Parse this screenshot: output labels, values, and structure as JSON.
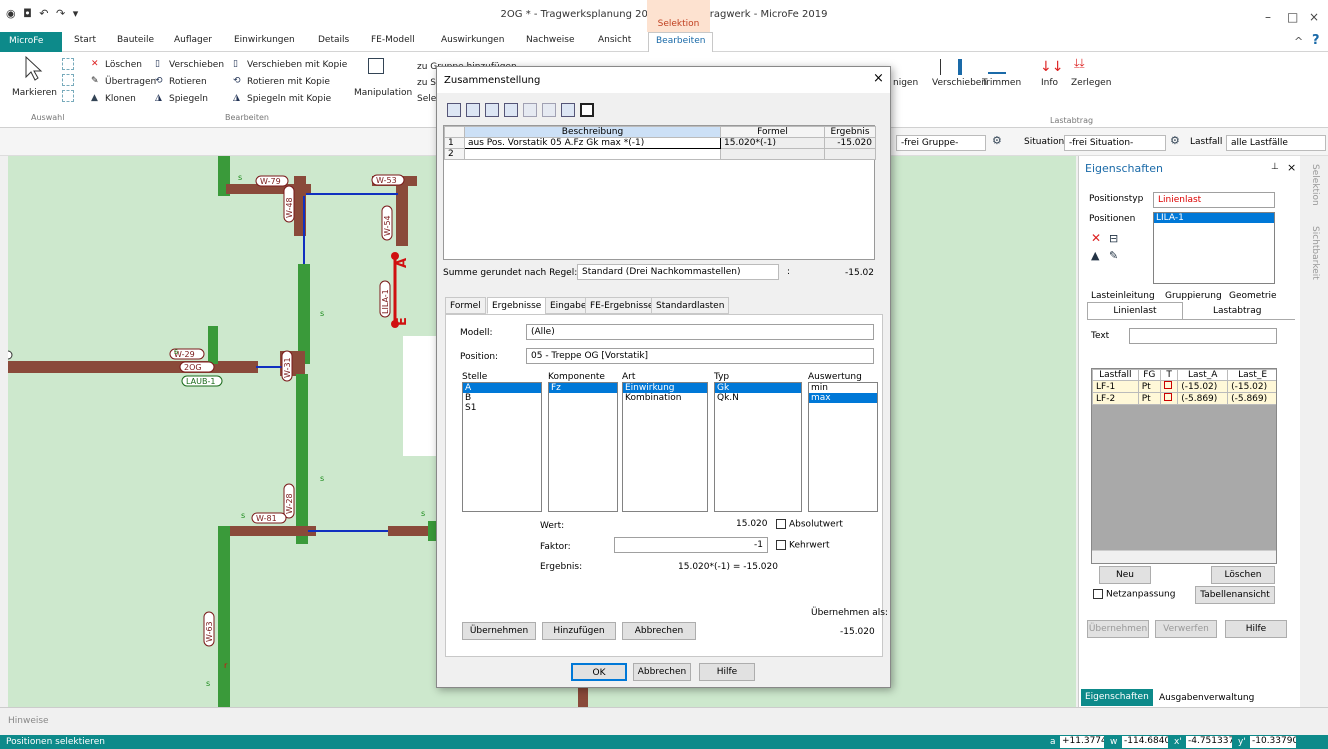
{
  "app": {
    "title": "2OG * - Tragwerksplanung 2019 - Plattentragwerk - MicroFe 2019",
    "context_tab": "Selektion",
    "minimize": "–",
    "restore": "□",
    "close": "×",
    "help": "?",
    "collapse": "^"
  },
  "tabs": [
    {
      "label": "MicroFe"
    },
    {
      "label": "Start"
    },
    {
      "label": "Bauteile"
    },
    {
      "label": "Auflager"
    },
    {
      "label": "Einwirkungen"
    },
    {
      "label": "Details"
    },
    {
      "label": "FE-Modell"
    },
    {
      "label": "Auswirkungen"
    },
    {
      "label": "Nachweise"
    },
    {
      "label": "Ansicht"
    },
    {
      "label": "Bearbeiten"
    }
  ],
  "ribbon": {
    "markieren": "Markieren",
    "auswahl": "Auswahl",
    "loeschen": "Löschen",
    "uebertragen": "Übertragen",
    "klonen": "Klonen",
    "verschieben": "Verschieben",
    "rotieren": "Rotieren",
    "spiegeln": "Spiegeln",
    "verschieben_kopie": "Verschieben mit Kopie",
    "rotieren_kopie": "Rotieren mit Kopie",
    "spiegeln_kopie": "Spiegeln mit Kopie",
    "bearbeiten": "Bearbeiten",
    "manipulation": "Manipulation",
    "zu_gruppe": "zu Gruppe hinzufügen",
    "zu_s": "zu S",
    "sele": "Sele",
    "nigen": "nigen",
    "verschieben2": "Verschieben",
    "trimmen": "Trimmen",
    "info": "Info",
    "zerlegen": "Zerlegen",
    "lastabtrag": "Lastabtrag"
  },
  "filterbar": {
    "gruppe": "-frei Gruppe-",
    "situation_label": "Situation",
    "situation": "-frei Situation-",
    "lastfall_label": "Lastfall",
    "lastfall": "alle Lastfälle"
  },
  "canvas_labels": [
    "W-79",
    "W-48",
    "W-53",
    "W-54",
    "W-29",
    "2OG",
    "LAUB-1",
    "W-31",
    "W-28",
    "W-81",
    "W-63",
    "LILA-1",
    "s",
    "A",
    "E",
    "r"
  ],
  "dialog": {
    "title": "Zusammenstellung",
    "close": "×",
    "grid": {
      "headers": [
        "Beschreibung",
        "Formel",
        "Ergebnis"
      ],
      "rows": [
        {
          "n": "1",
          "beschreibung": "aus Pos. Vorstatik 05 A.Fz Gk max *(-1)",
          "formel": "15.020*(-1)",
          "ergebnis": "-15.020"
        },
        {
          "n": "2",
          "beschreibung": "",
          "formel": "",
          "ergebnis": ""
        }
      ]
    },
    "summe_label": "Summe gerundet nach Regel:",
    "summe_regel": "Standard (Drei Nachkommastellen)",
    "summe_colon": ":",
    "summe_wert": "-15.02",
    "tabs": [
      "Formel",
      "Ergebnisse",
      "Eingabe",
      "FE-Ergebnisse",
      "Standardlasten"
    ],
    "modell_label": "Modell:",
    "modell": "(Alle)",
    "position_label": "Position:",
    "position": "05 - Treppe OG [Vorstatik]",
    "cols": {
      "stelle": "Stelle",
      "komponente": "Komponente",
      "art": "Art",
      "typ": "Typ",
      "auswertung": "Auswertung"
    },
    "stelle": [
      "A",
      "B",
      "S1"
    ],
    "komponente": [
      "Fz"
    ],
    "art": [
      "Einwirkung",
      "Kombination"
    ],
    "typ": [
      "Gk",
      "Qk.N"
    ],
    "auswertung": [
      "min",
      "max"
    ],
    "wert_label": "Wert:",
    "wert": "15.020",
    "absolutwert": "Absolutwert",
    "faktor_label": "Faktor:",
    "faktor": "-1",
    "kehrwert": "Kehrwert",
    "ergebnis_label": "Ergebnis:",
    "ergebnis": "15.020*(-1) = -15.020",
    "uebernehmen_als": "Übernehmen als:",
    "uebernehmen_wert": "-15.020",
    "btn_uebernehmen": "Übernehmen",
    "btn_hinzufuegen": "Hinzufügen",
    "btn_abbrechen": "Abbrechen",
    "ok": "OK",
    "abbrechen": "Abbrechen",
    "hilfe": "Hilfe"
  },
  "props": {
    "title": "Eigenschaften",
    "pin": "⊥",
    "close": "×",
    "positionstyp_label": "Positionstyp",
    "positionstyp": "Linienlast",
    "positionen_label": "Positionen",
    "positionen": [
      "LILA-1"
    ],
    "tabs_row1": [
      "Lasteinleitung",
      "Gruppierung",
      "Geometrie"
    ],
    "tabs_row2": [
      "Linienlast",
      "Lastabtrag"
    ],
    "text_label": "Text",
    "table_headers": [
      "Lastfall",
      "FG",
      "T",
      "Last_A",
      "Last_E"
    ],
    "table_rows": [
      {
        "lf": "LF-1",
        "fg": "Pt",
        "a": "(-15.02)",
        "e": "(-15.02)"
      },
      {
        "lf": "LF-2",
        "fg": "Pt",
        "a": "(-5.869)",
        "e": "(-5.869)"
      }
    ],
    "neu": "Neu",
    "loeschen": "Löschen",
    "netzanpassung": "Netzanpassung",
    "tabellenansicht": "Tabellenansicht",
    "uebernehmen": "Übernehmen",
    "verwerfen": "Verwerfen",
    "hilfe": "Hilfe",
    "bottom_tabs": [
      "Eigenschaften",
      "Ausgabenverwaltung"
    ]
  },
  "vtabs": [
    "Selektion",
    "Sichtbarkeit"
  ],
  "hints": "Hinweise",
  "status": {
    "text": "Positionen selektieren",
    "coords": [
      {
        "k": "a",
        "v": "+11.37749"
      },
      {
        "k": "w",
        "v": "-114.6840"
      },
      {
        "k": "x'",
        "v": "-4.751337"
      },
      {
        "k": "y'",
        "v": "-10.33790"
      }
    ]
  }
}
